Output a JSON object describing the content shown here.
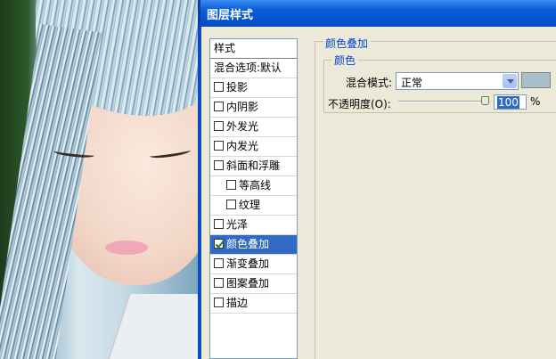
{
  "window": {
    "title": "图层样式"
  },
  "styles_panel": {
    "header": "样式",
    "items": [
      {
        "label": "混合选项:默认",
        "checkbox": false,
        "checked": false,
        "selected": false,
        "indent": false
      },
      {
        "label": "投影",
        "checkbox": true,
        "checked": false,
        "selected": false,
        "indent": false
      },
      {
        "label": "内阴影",
        "checkbox": true,
        "checked": false,
        "selected": false,
        "indent": false
      },
      {
        "label": "外发光",
        "checkbox": true,
        "checked": false,
        "selected": false,
        "indent": false
      },
      {
        "label": "内发光",
        "checkbox": true,
        "checked": false,
        "selected": false,
        "indent": false
      },
      {
        "label": "斜面和浮雕",
        "checkbox": true,
        "checked": false,
        "selected": false,
        "indent": false
      },
      {
        "label": "等高线",
        "checkbox": true,
        "checked": false,
        "selected": false,
        "indent": true
      },
      {
        "label": "纹理",
        "checkbox": true,
        "checked": false,
        "selected": false,
        "indent": true
      },
      {
        "label": "光泽",
        "checkbox": true,
        "checked": false,
        "selected": false,
        "indent": false
      },
      {
        "label": "颜色叠加",
        "checkbox": true,
        "checked": true,
        "selected": true,
        "indent": false
      },
      {
        "label": "渐变叠加",
        "checkbox": true,
        "checked": false,
        "selected": false,
        "indent": false
      },
      {
        "label": "图案叠加",
        "checkbox": true,
        "checked": false,
        "selected": false,
        "indent": false
      },
      {
        "label": "描边",
        "checkbox": true,
        "checked": false,
        "selected": false,
        "indent": false
      }
    ]
  },
  "color_overlay": {
    "group_title": "颜色叠加",
    "section_title": "颜色",
    "blend_mode_label": "混合模式:",
    "blend_mode_value": "正常",
    "overlay_color": "#a9bfc9",
    "opacity_label": "不透明度(O):",
    "opacity_value": "100",
    "opacity_unit": "%",
    "opacity_fraction": 1.0
  }
}
